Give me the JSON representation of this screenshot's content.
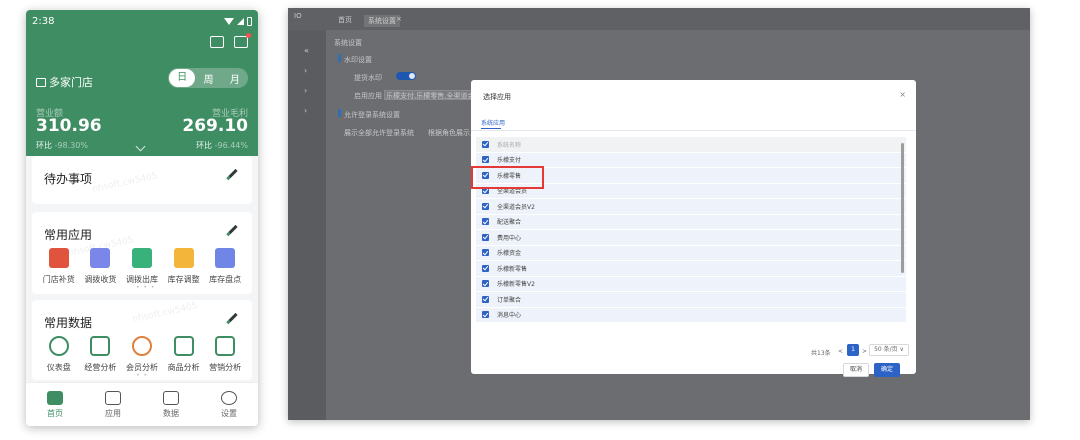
{
  "phone": {
    "status": {
      "time": "2:38"
    },
    "store_label": "多家门店",
    "period_tabs": [
      "日",
      "周",
      "月"
    ],
    "metrics": [
      {
        "label": "营业额",
        "value": "310.96",
        "compare_label": "环比",
        "compare_value": "-98.30%"
      },
      {
        "label": "营业毛利",
        "value": "269.10",
        "compare_label": "环比",
        "compare_value": "-96.44%"
      }
    ],
    "todo": {
      "title": "待办事项"
    },
    "apps": {
      "title": "常用应用",
      "items": [
        {
          "label": "门店补货",
          "color": "#e0533d"
        },
        {
          "label": "调拨收货",
          "color": "#7a86e8"
        },
        {
          "label": "调拨出库",
          "color": "#38b27a"
        },
        {
          "label": "库存调整",
          "color": "#f3b53a"
        },
        {
          "label": "库存盘点",
          "color": "#6f86e6"
        }
      ],
      "pager": "• • •"
    },
    "data_section": {
      "title": "常用数据",
      "items": [
        {
          "label": "仪表盘",
          "icon": "pie-chart-icon"
        },
        {
          "label": "经营分析",
          "icon": "trend-chart-icon"
        },
        {
          "label": "会员分析",
          "icon": "member-icon"
        },
        {
          "label": "商品分析",
          "icon": "shop-icon"
        },
        {
          "label": "营销分析",
          "icon": "marketing-icon"
        }
      ],
      "pager": "• •"
    },
    "watermark": "nhsoft.cw5405",
    "tabbar": [
      {
        "label": "首页",
        "active": true
      },
      {
        "label": "应用",
        "active": false
      },
      {
        "label": "数据",
        "active": false
      },
      {
        "label": "设置",
        "active": false
      }
    ],
    "colors": {
      "primary": "#3f8d63"
    }
  },
  "desktop": {
    "topbar": {
      "logo": "IO",
      "home_tab": "首页",
      "active_tab": "系统设置",
      "close": "×"
    },
    "background": {
      "section_title": "系统设置",
      "sub1": "水印设置",
      "toggle_label": "提货水印",
      "apply_label": "启用应用",
      "apply_value": "乐檬支付,乐檬零售,全渠道会员",
      "sub2": "允许登录系统设置",
      "radio1": "展示全部允许登录系统",
      "radio2": "根据角色展示允许..."
    },
    "modal": {
      "title": "选择应用",
      "close": "×",
      "tab": "系统应用",
      "header": "系统名称",
      "rows": [
        "乐檬支付",
        "乐檬零售",
        "全渠道会员",
        "全渠道会员V2",
        "配送聚合",
        "费用中心",
        "乐檬资金",
        "乐檬新零售",
        "乐檬新零售V2",
        "订单聚合",
        "消息中心"
      ],
      "pagination": {
        "total": "共13条",
        "prev": "<",
        "page": "1",
        "next": ">",
        "page_size": "50 条/页 ∨"
      },
      "cancel": "取消",
      "confirm": "确定"
    },
    "colors": {
      "accent": "#2d62c7",
      "highlight": "#e53935"
    }
  }
}
